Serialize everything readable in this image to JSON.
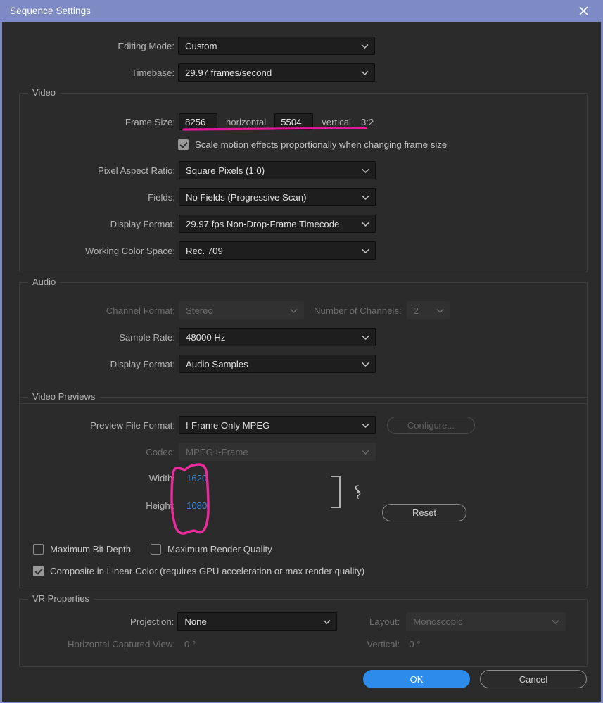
{
  "window": {
    "title": "Sequence Settings",
    "close_icon": "close-icon"
  },
  "top": {
    "editing_mode": {
      "label": "Editing Mode:",
      "value": "Custom"
    },
    "timebase": {
      "label": "Timebase:",
      "value": "29.97  frames/second"
    }
  },
  "video": {
    "legend": "Video",
    "frame_size": {
      "label": "Frame Size:",
      "horizontal_value": "8256",
      "horizontal_unit": "horizontal",
      "vertical_value": "5504",
      "vertical_unit": "vertical",
      "ratio": "3:2"
    },
    "scale_motion": {
      "label": "Scale motion effects proportionally when changing frame size",
      "checked": true
    },
    "pixel_aspect_ratio": {
      "label": "Pixel Aspect Ratio:",
      "value": "Square Pixels (1.0)"
    },
    "fields": {
      "label": "Fields:",
      "value": "No Fields (Progressive Scan)"
    },
    "display_format": {
      "label": "Display Format:",
      "value": "29.97 fps Non-Drop-Frame Timecode"
    },
    "working_color_space": {
      "label": "Working Color Space:",
      "value": "Rec. 709"
    }
  },
  "audio": {
    "legend": "Audio",
    "channel_format": {
      "label": "Channel Format:",
      "value": "Stereo",
      "disabled": true
    },
    "number_of_channels": {
      "label": "Number of Channels:",
      "value": "2",
      "disabled": true
    },
    "sample_rate": {
      "label": "Sample Rate:",
      "value": "48000 Hz"
    },
    "display_format": {
      "label": "Display Format:",
      "value": "Audio Samples"
    }
  },
  "video_previews": {
    "legend": "Video Previews",
    "preview_file_format": {
      "label": "Preview File Format:",
      "value": "I-Frame Only MPEG"
    },
    "configure_button": {
      "label": "Configure...",
      "disabled": true
    },
    "codec": {
      "label": "Codec:",
      "value": "MPEG I-Frame",
      "disabled": true
    },
    "width": {
      "label": "Width:",
      "value": "1620"
    },
    "height": {
      "label": "Height:",
      "value": "1080"
    },
    "link_icon": "link-chain-icon",
    "bracket_icon": "bracket-icon",
    "reset_button": {
      "label": "Reset"
    },
    "maximum_bit_depth": {
      "label": "Maximum Bit Depth",
      "checked": false
    },
    "maximum_render_quality": {
      "label": "Maximum Render Quality",
      "checked": false
    },
    "composite_linear_color": {
      "label": "Composite in Linear Color (requires GPU acceleration or max render quality)",
      "checked": true
    }
  },
  "vr_properties": {
    "legend": "VR Properties",
    "projection": {
      "label": "Projection:",
      "value": "None"
    },
    "layout": {
      "label": "Layout:",
      "value": "Monoscopic",
      "disabled": true
    },
    "horizontal_captured_view": {
      "label": "Horizontal Captured View:",
      "value": "0 °"
    },
    "vertical": {
      "label": "Vertical:",
      "value": "0 °"
    }
  },
  "footer": {
    "ok_button": "OK",
    "cancel_button": "Cancel"
  },
  "annotations": {
    "underline_color": "#e8159b",
    "circle_color": "#ef2a9e"
  },
  "colors": {
    "titlebar": "#7e8ac4",
    "dialog_background": "#2b2b2b",
    "field_background": "#1e1e1e",
    "accent_blue": "#2d8ceb",
    "value_blue": "#3f87d6"
  }
}
